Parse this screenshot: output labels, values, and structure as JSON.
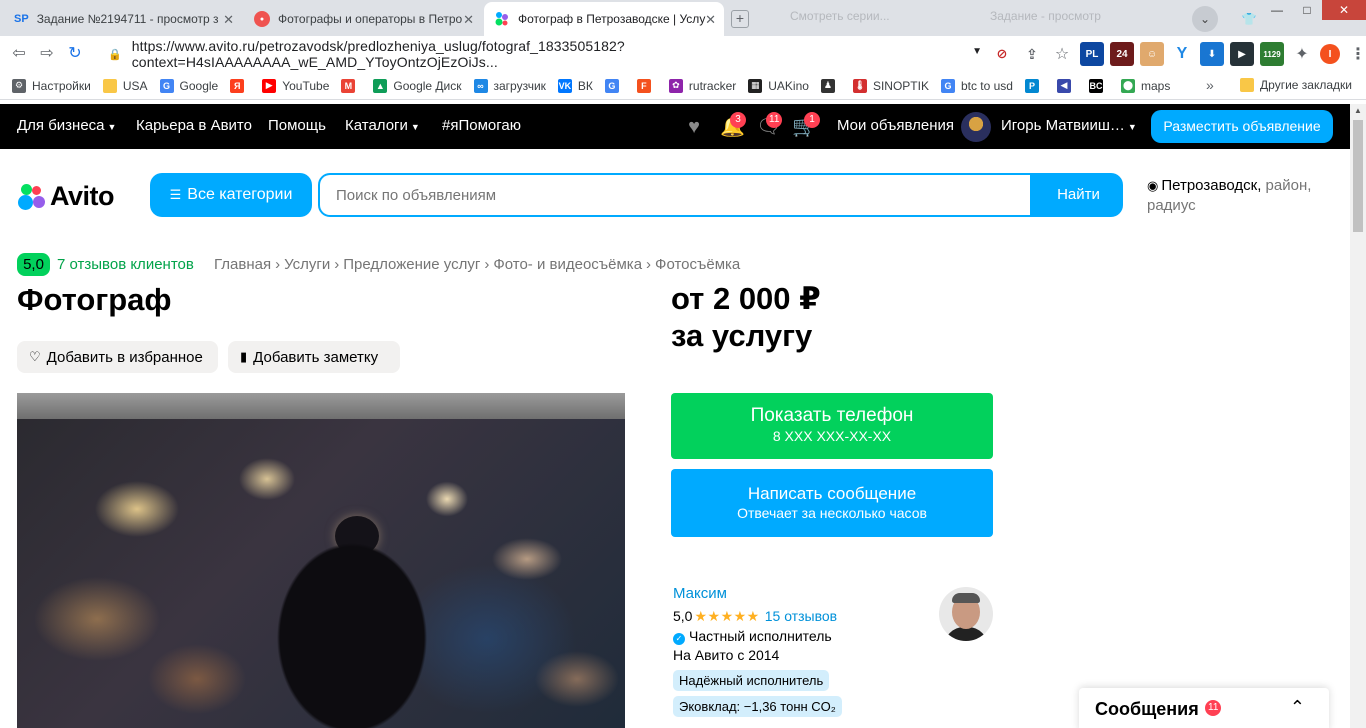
{
  "browser": {
    "tabs": [
      {
        "title": "Задание №2194711 - просмотр з",
        "favicon": "SP",
        "favicon_color": "#1a73e8"
      },
      {
        "title": "Фотографы и операторы в Петро",
        "favicon": "●",
        "favicon_color": "#ef5350"
      },
      {
        "title": "Фотограф в Петрозаводске | Услу",
        "favicon": "avito",
        "favicon_color": "#00aaff"
      }
    ],
    "ghost_tabs": [
      "Смотреть серии...",
      "Задание - просмотр"
    ],
    "new_tab_icon": "+",
    "window_controls": [
      "—",
      "□",
      "✕"
    ],
    "back_icon": "⇦",
    "forward_icon": "⇨",
    "reload_icon": "↻",
    "lock_icon": "🔒",
    "url": "https://www.avito.ru/petrozavodsk/predlozheniya_uslug/fotograf_1833505182?context=H4sIAAAAAAAA_wE_AMD_YToyOntzOjEzOiJs...",
    "extensions": [
      "PL",
      "24",
      "Y",
      "⬇",
      "▶",
      "1129",
      "✦",
      "I"
    ],
    "bookmarks": [
      {
        "label": "Настройки",
        "icon": "⚙",
        "color": "#5f6368"
      },
      {
        "label": "USA",
        "icon": "",
        "color": "#f9c747"
      },
      {
        "label": "Google",
        "icon": "G",
        "color": "#4285f4"
      },
      {
        "label": "",
        "icon": "Я",
        "color": "#fc3f1d"
      },
      {
        "label": "YouTube",
        "icon": "▶",
        "color": "#ff0000"
      },
      {
        "label": "",
        "icon": "M",
        "color": "#ea4335"
      },
      {
        "label": "Google Диск",
        "icon": "▲",
        "color": "#0f9d58"
      },
      {
        "label": "загрузчик",
        "icon": "∞",
        "color": "#1e88e5"
      },
      {
        "label": "ВК",
        "icon": "VK",
        "color": "#0077ff"
      },
      {
        "label": "",
        "icon": "G",
        "color": "#4285f4"
      },
      {
        "label": "",
        "icon": "F",
        "color": "#f4511e"
      },
      {
        "label": "rutracker",
        "icon": "✿",
        "color": "#8e24aa"
      },
      {
        "label": "UAKino",
        "icon": "▦",
        "color": "#222"
      },
      {
        "label": "",
        "icon": "♟",
        "color": "#333"
      },
      {
        "label": "SINOPTIK",
        "icon": "🌡",
        "color": "#d32f2f"
      },
      {
        "label": "btc to usd",
        "icon": "G",
        "color": "#4285f4"
      },
      {
        "label": "",
        "icon": "P",
        "color": "#0288d1"
      },
      {
        "label": "",
        "icon": "◀",
        "color": "#3949ab"
      },
      {
        "label": "",
        "icon": "BC",
        "color": "#000"
      },
      {
        "label": "maps",
        "icon": "⬤",
        "color": "#34a853"
      }
    ],
    "bookmarks_more": "»",
    "other_bookmarks": "Другие закладки"
  },
  "avito": {
    "topnav": {
      "for_business": "Для бизнеса",
      "career": "Карьера в Авито",
      "help": "Помощь",
      "catalogs": "Каталоги",
      "help_hashtag": "#яПомогаю",
      "notifications_count": "3",
      "messages_count": "11",
      "cart_count": "1",
      "my_ads": "Мои объявления",
      "user_name": "Игорь Матвииш…",
      "place_ad": "Разместить объявление"
    },
    "logo": "Avito",
    "all_categories": "Все категории",
    "search_placeholder": "Поиск по объявлениям",
    "search_button": "Найти",
    "location_city": "Петрозаводск,",
    "location_rest": " район, радиус"
  },
  "listing": {
    "rating": "5,0",
    "reviews_link": "7 отзывов клиентов",
    "breadcrumbs": [
      "Главная",
      "Услуги",
      "Предложение услуг",
      "Фото- и видеосъёмка",
      "Фотосъёмка"
    ],
    "title": "Фотограф",
    "add_favorite": "Добавить в избранное",
    "add_note": "Добавить заметку",
    "price_line1": "от 2 000 ₽",
    "price_line2": "за услугу",
    "show_phone": "Показать телефон",
    "phone_mask": "8 XXX XXX-XX-XX",
    "write_message": "Написать сообщение",
    "reply_time": "Отвечает за несколько часов"
  },
  "seller": {
    "name": "Максим",
    "rating": "5,0",
    "stars": "★★★★★",
    "reviews": "15 отзывов",
    "type": "Частный исполнитель",
    "since": "На Авито с 2014",
    "tag_reliable": "Надёжный исполнитель",
    "tag_eco": "Эковклад: −1,36 тонн CO₂"
  },
  "messages_panel": {
    "title": "Сообщения",
    "count": "11"
  }
}
